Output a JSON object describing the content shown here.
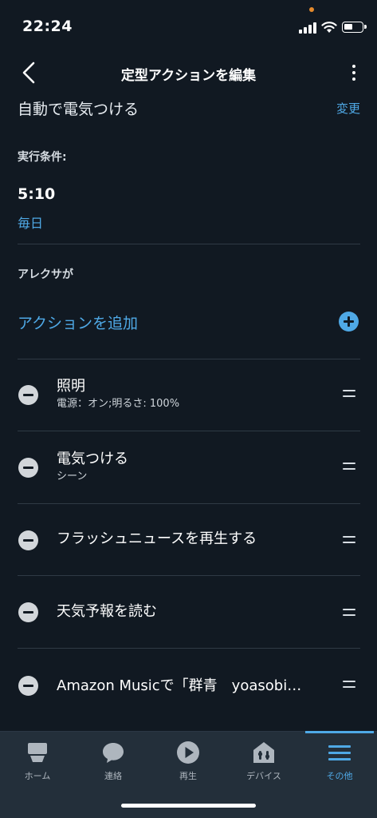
{
  "status_bar": {
    "time": "22:24"
  },
  "nav": {
    "title": "定型アクションを編集"
  },
  "routine": {
    "name": "自動で電気つける",
    "change_label": "変更"
  },
  "condition": {
    "label": "実行条件:",
    "time": "5:10",
    "repeat": "毎日"
  },
  "alexa_section": {
    "label": "アレクサが",
    "add_action_label": "アクションを追加"
  },
  "actions": [
    {
      "title": "照明",
      "subtitle": "電源：オン;明るさ: 100%"
    },
    {
      "title": "電気つける",
      "subtitle": "シーン"
    },
    {
      "title": "フラッシュニュースを再生する",
      "subtitle": ""
    },
    {
      "title": "天気予報を読む",
      "subtitle": ""
    },
    {
      "title": "Amazon Musicで「群青　yoasobi…",
      "subtitle": ""
    }
  ],
  "tab_bar": {
    "tabs": [
      {
        "label": "ホーム",
        "icon": "home-icon",
        "active": false
      },
      {
        "label": "連絡",
        "icon": "chat-bubble-icon",
        "active": false
      },
      {
        "label": "再生",
        "icon": "play-icon",
        "active": false
      },
      {
        "label": "デバイス",
        "icon": "devices-icon",
        "active": false
      },
      {
        "label": "その他",
        "icon": "menu-icon",
        "active": true
      }
    ]
  },
  "colors": {
    "background": "#111922",
    "accent": "#4fa9e6",
    "tab_bar": "#232f3a"
  }
}
